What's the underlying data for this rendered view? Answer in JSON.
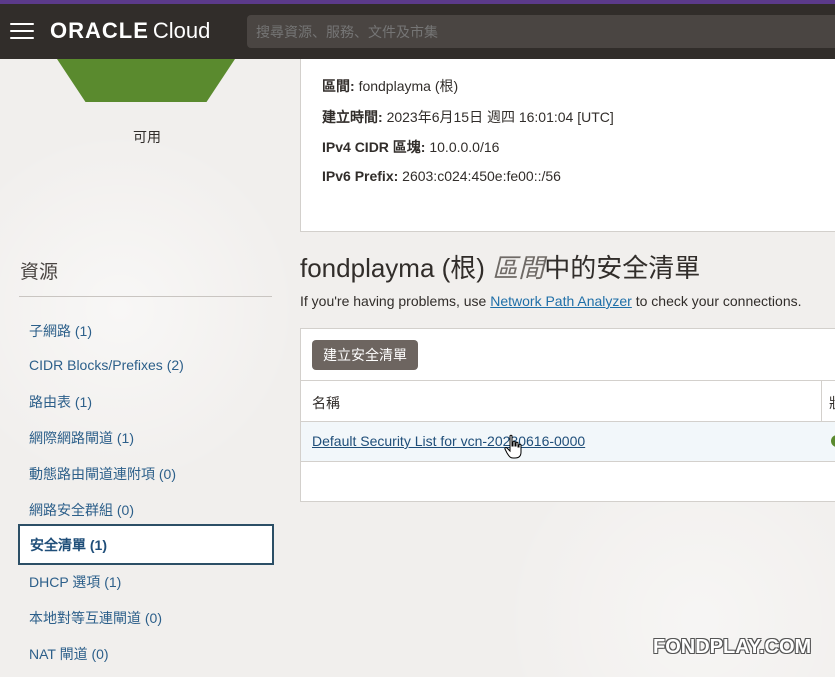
{
  "header": {
    "brand": "ORACLE",
    "product": "Cloud",
    "search_placeholder": "搜尋資源、服務、文件及市集"
  },
  "status": {
    "label": "可用",
    "color": "#5a8a2e"
  },
  "details": {
    "compartment_label": "區間:",
    "compartment_value": "fondplayma (根)",
    "created_label": "建立時間:",
    "created_value": "2023年6月15日 週四 16:01:04 [UTC]",
    "ipv4_label": "IPv4 CIDR 區塊:",
    "ipv4_value": "10.0.0.0/16",
    "ipv6_label": "IPv6 Prefix:",
    "ipv6_value": "2603:c024:450e:fe00::/56"
  },
  "resources": {
    "title": "資源",
    "items": [
      {
        "label": "子網路 (1)",
        "active": false
      },
      {
        "label": "CIDR Blocks/Prefixes (2)",
        "active": false
      },
      {
        "label": "路由表 (1)",
        "active": false
      },
      {
        "label": "網際網路閘道 (1)",
        "active": false
      },
      {
        "label": "動態路由閘道連附項 (0)",
        "active": false
      },
      {
        "label": "網路安全群組 (0)",
        "active": false
      },
      {
        "label": "安全清單 (1)",
        "active": true
      },
      {
        "label": "DHCP 選項 (1)",
        "active": false
      },
      {
        "label": "本地對等互連閘道 (0)",
        "active": false
      },
      {
        "label": "NAT 閘道 (0)",
        "active": false
      }
    ]
  },
  "main": {
    "title_prefix": "fondplayma (根)",
    "title_italic": "區間",
    "title_suffix": "中的安全清單",
    "help_before": "If you're having problems, use",
    "help_link": "Network Path Analyzer",
    "help_after": "to check your connections.",
    "create_button": "建立安全清單",
    "table": {
      "columns": [
        "名稱",
        "狀"
      ],
      "rows": [
        {
          "name": "Default Security List for vcn-20230616-0000",
          "state_color": "#5a8a2e"
        }
      ]
    }
  },
  "watermark": "FONDPLAY.COM"
}
